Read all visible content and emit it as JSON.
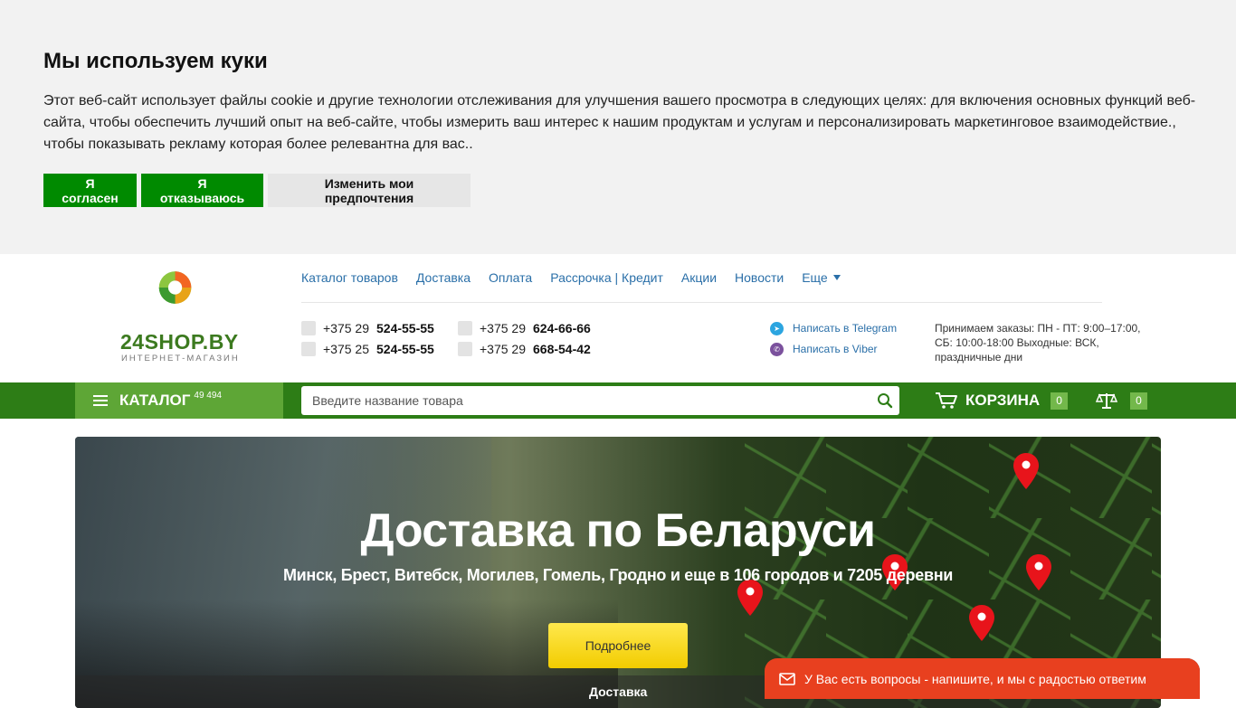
{
  "cookie": {
    "title": "Мы используем куки",
    "text": "Этот веб-сайт использует файлы cookie и другие технологии отслеживания для улучшения вашего просмотра в следующих целях: для включения основных функций веб-сайта, чтобы обеспечить лучший опыт на веб-сайте, чтобы измерить ваш интерес к нашим продуктам и услугам и персонализировать маркетинговое взаимодействие., чтобы показывать рекламу которая более релевантна для вас..",
    "accept_label": "Я согласен",
    "decline_label": "Я отказываюсь",
    "prefs_label": "Изменить мои предпочтения"
  },
  "logo": {
    "name": "24SHOP.BY",
    "tagline": "ИНТЕРНЕТ-МАГАЗИН"
  },
  "nav": {
    "items": [
      "Каталог товаров",
      "Доставка",
      "Оплата",
      "Рассрочка | Кредит",
      "Акции",
      "Новости"
    ],
    "more_label": "Еще"
  },
  "phones": [
    {
      "prefix": "+375 29",
      "number": "524-55-55"
    },
    {
      "prefix": "+375 29",
      "number": "624-66-66"
    },
    {
      "prefix": "+375 25",
      "number": "524-55-55"
    },
    {
      "prefix": "+375 29",
      "number": "668-54-42"
    }
  ],
  "messengers": {
    "telegram": "Написать в Telegram",
    "viber": "Написать в Viber"
  },
  "hours": "Принимаем заказы: ПН - ПТ: 9:00–17:00, СБ: 10:00-18:00 Выходные: ВСК, праздничные дни",
  "bar": {
    "catalog_label": "КАТАЛОГ",
    "catalog_count": "49 494",
    "search_placeholder": "Введите название товара",
    "cart_label": "КОРЗИНА",
    "cart_count": "0",
    "compare_count": "0"
  },
  "banner": {
    "title": "Доставка по Беларуси",
    "subtitle": "Минск, Брест, Витебск, Могилев, Гомель, Гродно и еще в 106 городов и 7205 деревни",
    "button_label": "Подробнее",
    "footer_label": "Доставка"
  },
  "chat": {
    "text": "У Вас есть вопросы - напишите, и мы с радостью ответим"
  },
  "colors": {
    "green_bar": "#2d7d16",
    "catalog_green": "#5ea636",
    "cookie_button": "#008a00",
    "link": "#2a6fa8",
    "chat": "#e8401f",
    "button_yellow": "#ffe84d"
  }
}
